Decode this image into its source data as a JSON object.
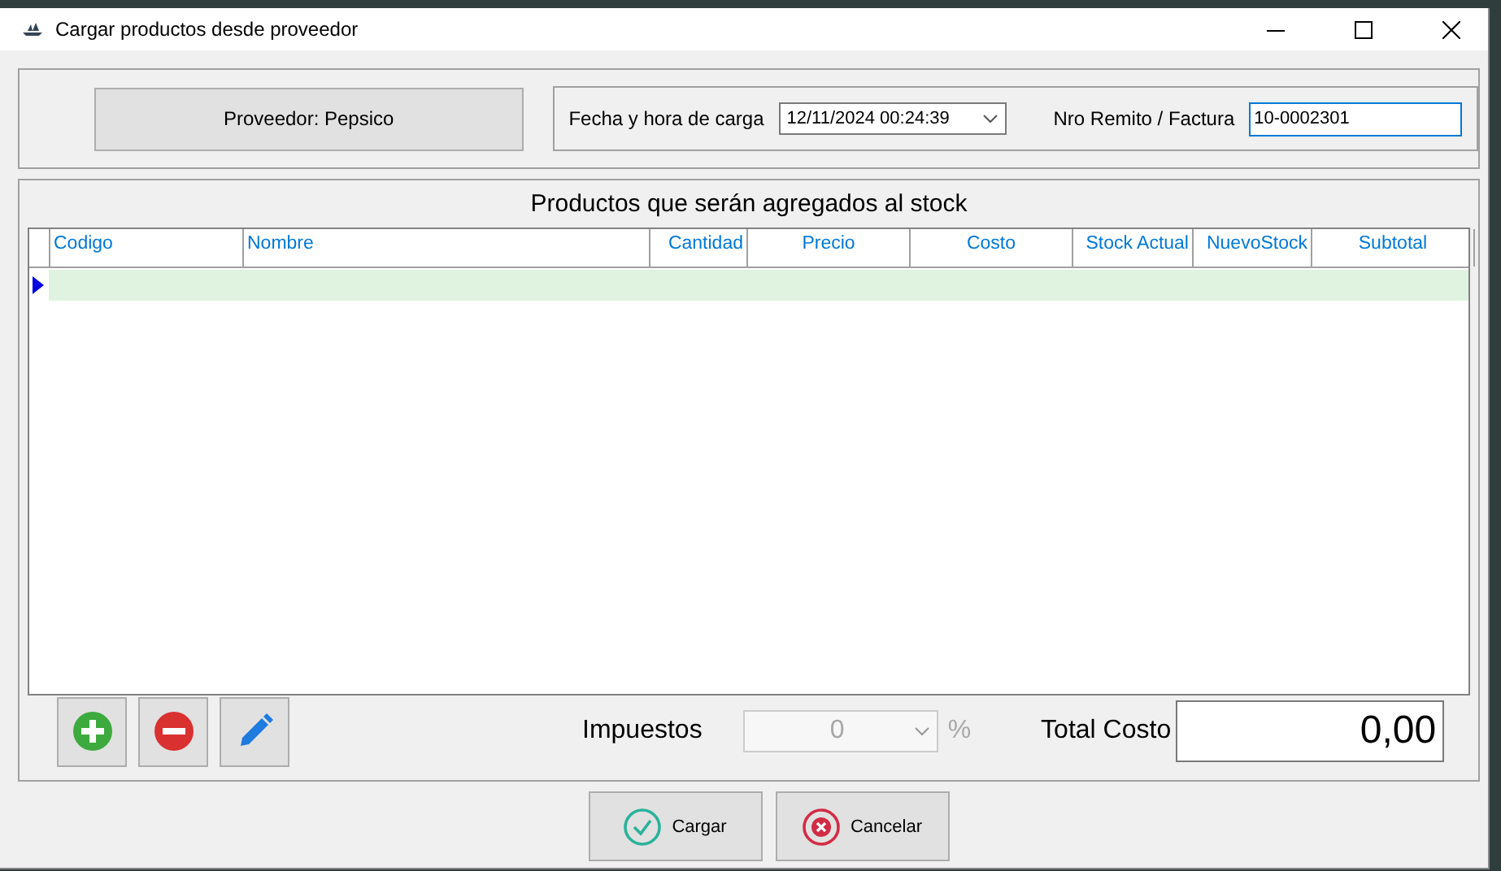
{
  "window": {
    "title": "Cargar productos desde proveedor"
  },
  "proveedor_button": {
    "label": "Proveedor: Pepsico"
  },
  "fecha": {
    "label": "Fecha y hora de carga",
    "value": "12/11/2024 00:24:39"
  },
  "remito": {
    "label": "Nro Remito / Factura",
    "value": "10-0002301"
  },
  "table": {
    "title": "Productos que serán agregados al stock",
    "columns": [
      "Codigo",
      "Nombre",
      "Cantidad",
      "Precio",
      "Costo",
      "Stock Actual",
      "NuevoStock",
      "Subtotal"
    ],
    "rows": [
      {
        "selected": true
      }
    ]
  },
  "toolbar": [
    {
      "kind": "add"
    },
    {
      "kind": "remove"
    },
    {
      "kind": "edit"
    }
  ],
  "impuestos": {
    "label": "Impuestos",
    "value": "0",
    "unit": "%",
    "disabled": true
  },
  "total": {
    "label": "Total Costo",
    "value": "0,00"
  },
  "buttons": [
    {
      "kind": "ok",
      "label": "Cargar"
    },
    {
      "kind": "cancel",
      "label": "Cancelar"
    }
  ]
}
